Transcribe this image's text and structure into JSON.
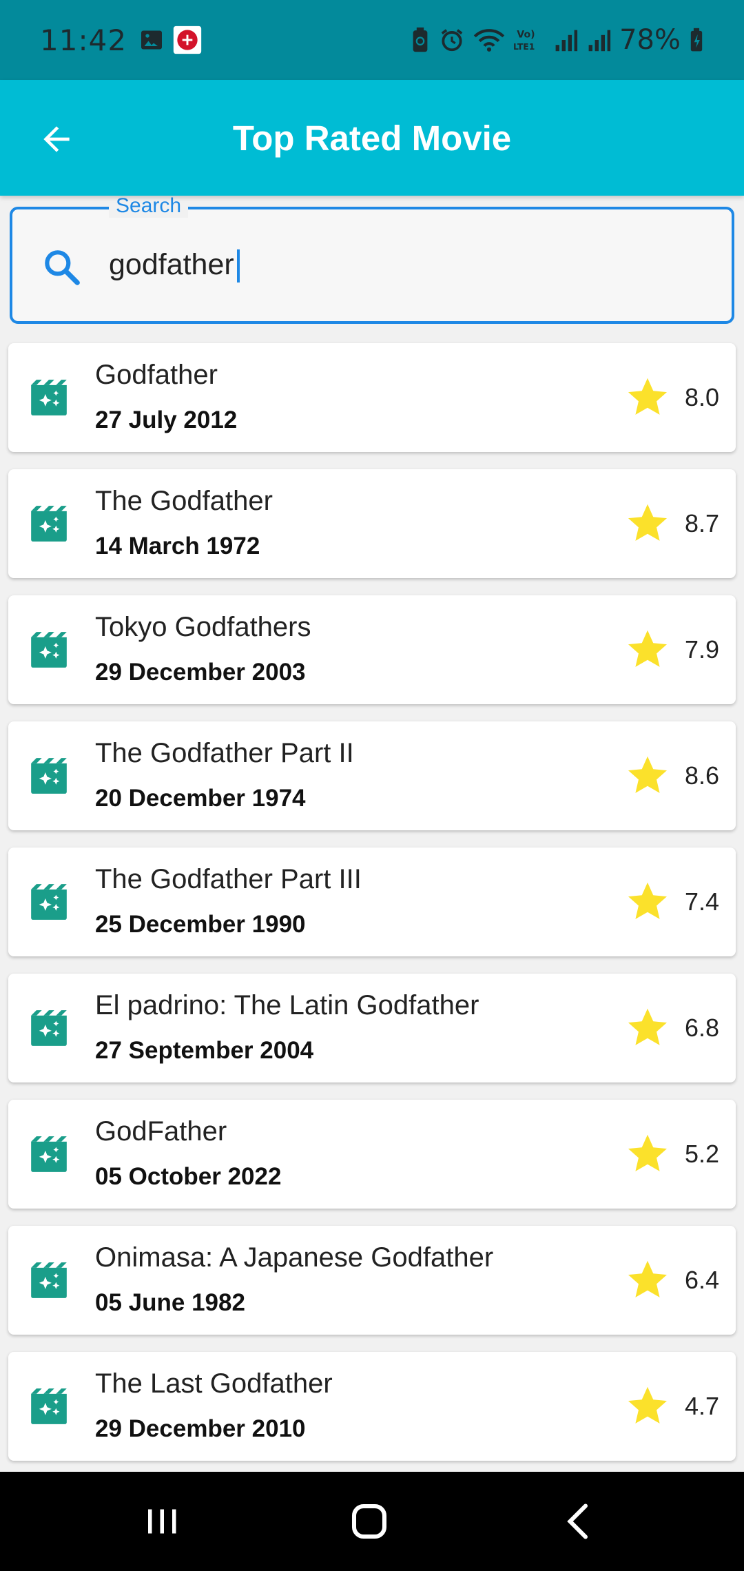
{
  "status_bar": {
    "time": "11:42",
    "battery_percent": "78%",
    "left_icons": [
      "image-icon",
      "pizza-app-icon"
    ],
    "right_icons": [
      "battery-saver-icon",
      "alarm-icon",
      "wifi-icon",
      "volte-lte1-icon",
      "signal-icon",
      "signal-icon",
      "battery-charging-icon"
    ]
  },
  "app_bar": {
    "title": "Top Rated Movie",
    "back_icon": "arrow-back-icon",
    "background": "#00bcd4"
  },
  "search": {
    "label": "Search",
    "value": "godfather",
    "icon": "search-icon",
    "accent": "#1e88e5"
  },
  "movies": [
    {
      "title": "Godfather",
      "date": "27 July 2012",
      "rating": "8.0"
    },
    {
      "title": "The Godfather",
      "date": "14 March 1972",
      "rating": "8.7"
    },
    {
      "title": "Tokyo Godfathers",
      "date": "29 December 2003",
      "rating": "7.9"
    },
    {
      "title": "The Godfather Part II",
      "date": "20 December 1974",
      "rating": "8.6"
    },
    {
      "title": "The Godfather Part III",
      "date": "25 December 1990",
      "rating": "7.4"
    },
    {
      "title": "El padrino: The Latin Godfather",
      "date": "27 September 2004",
      "rating": "6.8"
    },
    {
      "title": "GodFather",
      "date": "05 October 2022",
      "rating": "5.2"
    },
    {
      "title": "Onimasa: A Japanese Godfather",
      "date": "05 June 1982",
      "rating": "6.4"
    },
    {
      "title": "The Last Godfather",
      "date": "29 December 2010",
      "rating": "4.7"
    }
  ],
  "colors": {
    "movie_icon": "#1a9e8a",
    "star": "#fbe12b",
    "status_bar": "#038a9b"
  },
  "nav_bar": {
    "icons": [
      "recent-apps-icon",
      "home-icon",
      "back-nav-icon"
    ]
  }
}
